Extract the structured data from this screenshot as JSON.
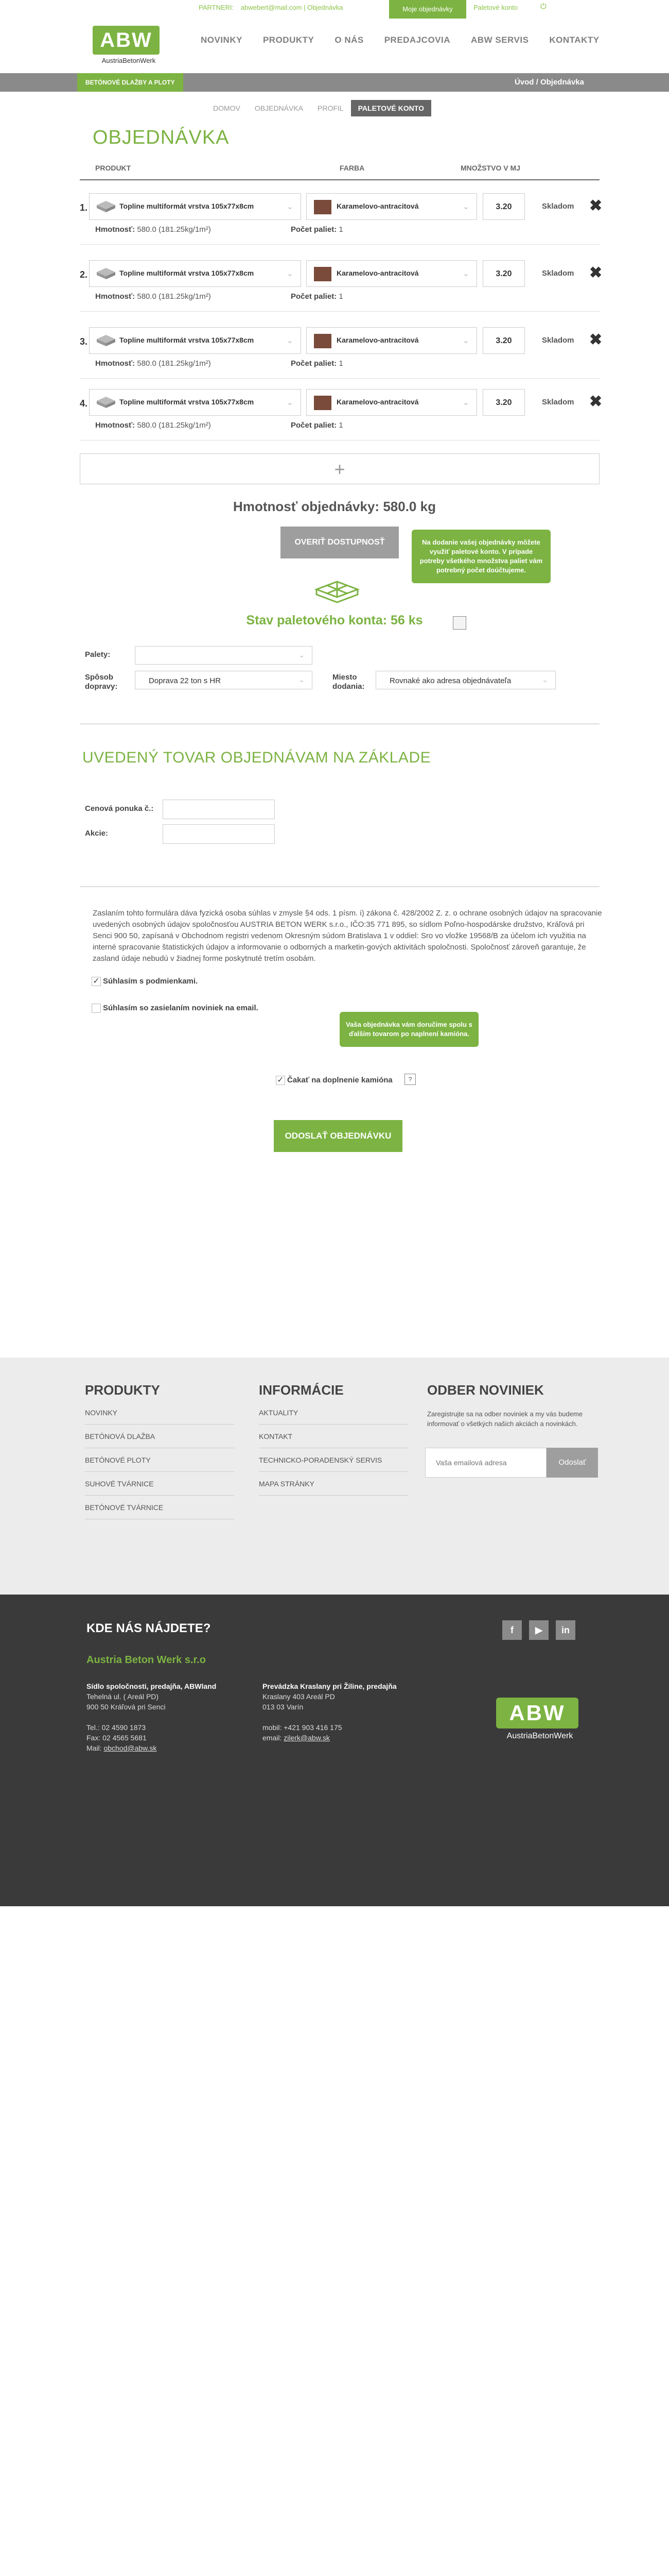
{
  "header": {
    "partners_label": "PARTNERI:",
    "partner_email": "abwebert@mail.com",
    "partner_links": [
      "Objednávka"
    ],
    "my_orders": "Moje objednávky",
    "pallet_account": "Paletové konto",
    "logout_icon": "power-icon",
    "logo_text": "ABW",
    "logo_sub": "AustriaBetonWerk",
    "nav": [
      "NOVINKY",
      "PRODUKTY",
      "O NÁS",
      "PREDAJCOVIA",
      "ABW SERVIS",
      "KONTAKTY"
    ]
  },
  "greybar": {
    "category": "BETÓNOVÉ DLAŽBY A PLOTY",
    "breadcrumb": "Úvod  /  Objednávka"
  },
  "subtabs": [
    "DOMOV",
    "OBJEDNÁVKA",
    "PROFIL",
    "PALETOVÉ KONTO"
  ],
  "page_title": "OBJEDNÁVKA",
  "table": {
    "headers": {
      "product": "PRODUKT",
      "color": "FARBA",
      "qty": "MNOŽSTVO V MJ"
    },
    "rows": [
      {
        "num": "1.",
        "product": "Topline multiformát vrstva 105x77x8cm",
        "color": "Karamelovo-antracitová",
        "qty": "3.20",
        "stock": "Skladom",
        "weight_label": "Hmotnosť:",
        "weight": "580.0  (181.25kg/1m²)",
        "pallets_label": "Počet paliet:",
        "pallets": "1"
      },
      {
        "num": "2.",
        "product": "Topline multiformát vrstva 105x77x8cm",
        "color": "Karamelovo-antracitová",
        "qty": "3.20",
        "stock": "Skladom",
        "weight_label": "Hmotnosť:",
        "weight": "580.0  (181.25kg/1m²)",
        "pallets_label": "Počet paliet:",
        "pallets": "1"
      },
      {
        "num": "3.",
        "product": "Topline multiformát vrstva 105x77x8cm",
        "color": "Karamelovo-antracitová",
        "qty": "3.20",
        "stock": "Skladom",
        "weight_label": "Hmotnosť:",
        "weight": "580.0  (181.25kg/1m²)",
        "pallets_label": "Počet paliet:",
        "pallets": "1"
      },
      {
        "num": "4.",
        "product": "Topline multiformát vrstva 105x77x8cm",
        "color": "Karamelovo-antracitová",
        "qty": "3.20",
        "stock": "Skladom",
        "weight_label": "Hmotnosť:",
        "weight": "580.0  (181.25kg/1m²)",
        "pallets_label": "Počet paliet:",
        "pallets": "1"
      }
    ],
    "add_label": "+"
  },
  "summary": {
    "weight": "Hmotnosť objednávky: 580.0 kg",
    "verify": "OVERIŤ DOSTUPNOSŤ",
    "tooltip": "Na dodanie vašej objednávky môžete využiť paletové konto. V prípade potreby všetkého množstva paliet vám potrebný počet doúčtujeme.",
    "pallet_status": "Stav paletového konta: 56 ks"
  },
  "delivery": {
    "pallets_label": "Palety:",
    "pallets_value": "",
    "transport_label": "Spôsob dopravy:",
    "transport_value": "Doprava 22 ton s HR",
    "place_label": "Miesto dodania:",
    "place_value": "Rovnaké ako adresa objednávateľa"
  },
  "basis": {
    "title": "UVEDENÝ TOVAR OBJEDNÁVAM NA ZÁKLADE",
    "quote_label": "Cenová ponuka č.:",
    "action_label": "Akcie:"
  },
  "legal": "Zaslaním tohto formulára dáva fyzická osoba súhlas v zmysle §4 ods. 1 písm. i) zákona č. 428/2002 Z. z. o ochrane osobných údajov na spracovanie uvedených osobných údajov spoločnosťou AUSTRIA BETON WERK s.r.o., IČO:35 771 895, so sídlom Poľno-hospodárske družstvo, Kráľová pri Senci 900 50, zapísaná v Obchodnom registri vedenom Okresným súdom Bratislava 1 v oddiel: Sro vo vložke 19568/B za účelom ich využitia na interné spracovanie štatistických údajov a informovanie o odborných a marketin-gových aktivitách spoločnosti. Spoločnosť zároveň garantuje, že zasland údaje nebudú v žiadnej forme poskytnuté tretím osobám.",
  "consents": {
    "terms": "Súhlasím s podmienkami.",
    "newsletter": "Súhlasím so zasielaním noviniek na email.",
    "truck_tooltip": "Vaša objednávka vám doručíme spolu s ďalším tovarom po naplnení kamióna.",
    "truck": "Čakať na doplnenie kamióna",
    "help": "?"
  },
  "send_button": "ODOSLAŤ OBJEDNÁVKU",
  "footer": {
    "products_title": "PRODUKTY",
    "products": [
      "NOVINKY",
      "BETÓNOVÁ DLAŽBA",
      "BETÓNOVÉ PLOTY",
      "SUHOVÉ TVÁRNICE",
      "BETÓNOVÉ TVÁRNICE"
    ],
    "info_title": "INFORMÁCIE",
    "info": [
      "AKTUALITY",
      "KONTAKT",
      "TECHNICKO-PORADENSKÝ SERVIS",
      "MAPA STRÁNKY"
    ],
    "newsletter_title": "ODBER NOVINIEK",
    "newsletter_text": "Zaregistrujte sa na odber noviniek a my vás budeme informovať o všetkých našich akciách a novinkách.",
    "newsletter_placeholder": "Vaša emailová adresa",
    "newsletter_button": "Odoslať",
    "where_title": "KDE NÁS NÁJDETE?",
    "company": "Austria Beton Werk s.r.o",
    "addr1_title": "Sídlo spoločnosti, predajňa, ABWland",
    "addr1": [
      "Tehelná ul. ( Areál PD)",
      "900 50 Kráľová pri Senci",
      "",
      "Tel.: 02 4590 1873",
      "Fax: 02 4565 5681"
    ],
    "addr1_mail_label": "Mail:",
    "addr1_mail": "obchod@abw.sk",
    "addr2_title": "Prevádzka Kraslany pri Žiline, predajňa",
    "addr2": [
      "Kraslany 403 Areál PD",
      "013 03 Varín",
      "",
      "mobil: +421 903 416 175"
    ],
    "addr2_mail_label": "email:",
    "addr2_mail": "zilerk@abw.sk",
    "social": [
      "f",
      "▶",
      "in"
    ],
    "logo_text": "ABW",
    "logo_sub": "AustriaBetonWerk"
  }
}
